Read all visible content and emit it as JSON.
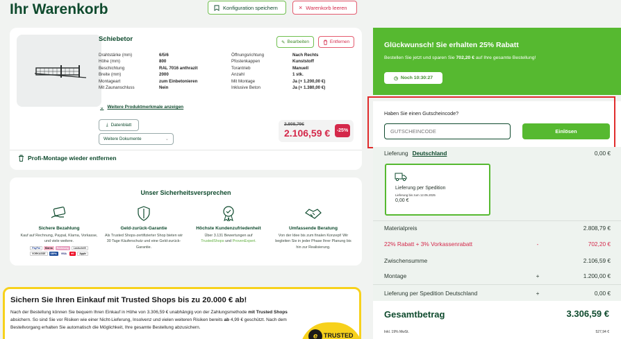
{
  "header": {
    "title": "Ihr Warenkorb",
    "save_config": "Konfiguration speichern",
    "clear_cart": "Warenkorb leeren"
  },
  "product": {
    "name": "Schiebetor",
    "edit": "Bearbeiten",
    "remove": "Entfernen",
    "specs_left": [
      {
        "label": "Drahtstärke (mm)",
        "value": "6/5/6"
      },
      {
        "label": "Höhe (mm)",
        "value": "800"
      },
      {
        "label": "Beschichtung",
        "value": "RAL 7016 anthrazit"
      },
      {
        "label": "Breite (mm)",
        "value": "2000"
      },
      {
        "label": "Montageart",
        "value": "zum Einbetonieren"
      },
      {
        "label": "Mit Zaunanschluss",
        "value": "Nein"
      }
    ],
    "specs_right": [
      {
        "label": "Öffnungsrichtung",
        "value": "Nach Rechts"
      },
      {
        "label": "Pfostenkappen",
        "value": "Kunststoff"
      },
      {
        "label": "Torantrieb",
        "value": "Manuell"
      },
      {
        "label": "Anzahl",
        "value": "1 stk."
      },
      {
        "label": "Mit Montage",
        "value": "Ja (+ 1.200,00 €)"
      },
      {
        "label": "Inklusive Beton",
        "value": "Ja (+ 1.380,00 €)"
      }
    ],
    "more_link": "Weitere Produktmerkmale anzeigen",
    "datasheet": "Datenblatt",
    "docs_select": "Weitere Dokumente",
    "price_old": "2.808,79€",
    "price_new": "2.106,59 €",
    "discount_badge": "-25%",
    "profi_remove": "Profi-Montage wieder entfernen"
  },
  "security": {
    "title": "Unser Sicherheitsversprechen",
    "items": [
      {
        "heading": "Sichere Bezahlung",
        "text": "Kauf auf Rechnung, Paypal, Klarna, Vorkasse, und viele weitere."
      },
      {
        "heading": "Geld-zurück-Garantie",
        "text": "Als Trusted Shops-zertifizierter Shop bieten wir 30 Tage Käuferschutz und eine Geld-zurück-Garantie."
      },
      {
        "heading": "Höchste Kundenzufriedenheit",
        "text_pre": "Über 3.131 Bewertungen auf",
        "link1": "TrustedShops",
        "and": "und",
        "link2": "ProvenExpert."
      },
      {
        "heading": "Umfassende Beratung",
        "text": "Von der Idee bis zum finalen Konzept! Wir begleiten Sie in jeder Phase Ihrer Planung bis hin zur Realisierung."
      }
    ],
    "paylogos": [
      "PayPal",
      "Klarna",
      "Rechnung",
      "Lastschrift",
      "VORKASSE",
      "SEPA",
      "VISA",
      "MC",
      "Apple"
    ]
  },
  "trusted": {
    "title": "Sichern Sie Ihren Einkauf mit Trusted Shops bis zu 20.000 € ab!",
    "p1": "Nach der Bestellung können Sie bequem Ihren Einkauf in Höhe von 3.306,59 € unabhängig von der Zahlungsmethode ",
    "p1_bold": "mit Trusted Shops",
    "p2": " absichern. So sind Sie vor Risiken wie einer Nicht-Lieferung, Insolvenz und vielen weiteren Risiken bereits ",
    "p2_bold": "ab",
    "p3": " 4,99 € geschützt. Nach dem Bestellvorgang erhalten Sie automatisch die Möglichkeit, Ihre gesamte Bestellung abzusichern.",
    "logo_letter": "e",
    "logo_word": "TRUSTED"
  },
  "promo": {
    "heading": "Glückwunsch! Sie erhalten 25% Rabatt",
    "sub_pre": "Bestellen Sie jetzt und sparen Sie",
    "sub_amount": "702,20 €",
    "sub_post": "auf Ihre gesamte Bestellung!",
    "timer": "Noch 10:30:27"
  },
  "voucher": {
    "label": "Haben Sie einen Gutscheincode?",
    "placeholder": "GUTSCHEINCODE",
    "button": "Einlösen"
  },
  "summary": {
    "delivery_label": "Lieferung",
    "delivery_country": "Deutschland",
    "delivery_value": "0,00 €",
    "ship_name": "Lieferung per Spedition",
    "ship_date": "Lieferung bis zum 12.05.2025",
    "ship_price": "0,00 €",
    "rows": [
      {
        "label": "Materialpreis",
        "op": "",
        "value": "2.808,79 €"
      },
      {
        "label": "22% Rabatt + 3% Vorkassenrabatt",
        "op": "-",
        "value": "702,20 €"
      },
      {
        "label": "Zwischensumme",
        "op": "",
        "value": "2.106,59 €"
      },
      {
        "label": "Montage",
        "op": "+",
        "value": "1.200,00 €"
      },
      {
        "label": "Lieferung per Spedition Deutschland",
        "op": "+",
        "value": "0,00 €"
      }
    ],
    "total_label": "Gesamtbetrag",
    "total_value": "3.306,59 €",
    "vat_label": "Inkl. 19% MwSt.",
    "vat_value": "527,94 €"
  },
  "colors": {
    "brand_green": "#0e4a2d",
    "accent_green": "#56b930",
    "alert_red": "#d4284a",
    "trusted_yellow": "#f7d11c"
  }
}
